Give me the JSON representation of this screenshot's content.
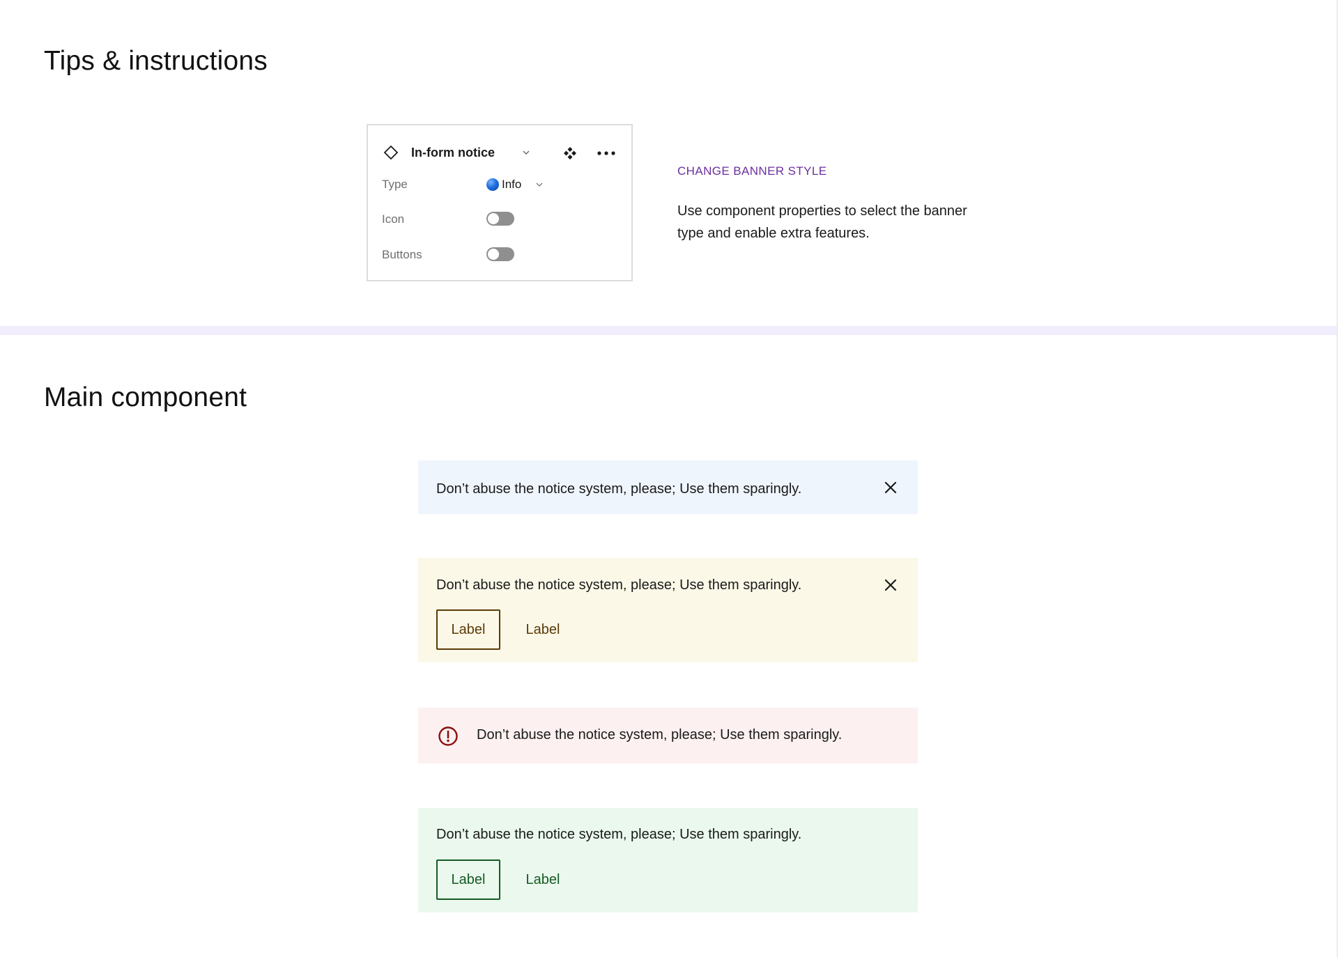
{
  "sections": {
    "tips_title": "Tips & instructions",
    "main_title": "Main component"
  },
  "panel": {
    "component_name": "In-form notice",
    "icons": {
      "component": "diamond-icon",
      "caret": "chevron-down-icon",
      "instance": "component-instance-icon",
      "more": "more-horizontal-icon"
    },
    "properties": [
      {
        "label": "Type",
        "value": "Info",
        "kind": "select",
        "dot_color": "#1f6fe0"
      },
      {
        "label": "Icon",
        "kind": "toggle",
        "on": false
      },
      {
        "label": "Buttons",
        "kind": "toggle",
        "on": false
      }
    ]
  },
  "tip": {
    "heading": "CHANGE BANNER STYLE",
    "body": "Use component properties to select the banner type and enable extra features."
  },
  "notices": [
    {
      "variant": "info",
      "message": "Don’t abuse the notice system, please; Use them sparingly.",
      "dismissible": true,
      "background": "#eff5fc"
    },
    {
      "variant": "warning",
      "message": "Don’t abuse the notice system, please; Use them sparingly.",
      "dismissible": true,
      "background": "#fbf8e8",
      "accent": "#5b3a06",
      "buttons": [
        "Label",
        "Label"
      ]
    },
    {
      "variant": "error",
      "message": "Don’t abuse the notice system, please; Use them sparingly.",
      "icon": "alert-circle-icon",
      "background": "#fcf0f0",
      "accent": "#8a1010"
    },
    {
      "variant": "success",
      "message": "Don’t abuse the notice system, please; Use them sparingly.",
      "background": "#eaf8ee",
      "accent": "#155a22",
      "buttons": [
        "Label",
        "Label"
      ]
    }
  ],
  "colors": {
    "divider": "#f1edfd",
    "tip_heading": "#6b2fa0"
  }
}
